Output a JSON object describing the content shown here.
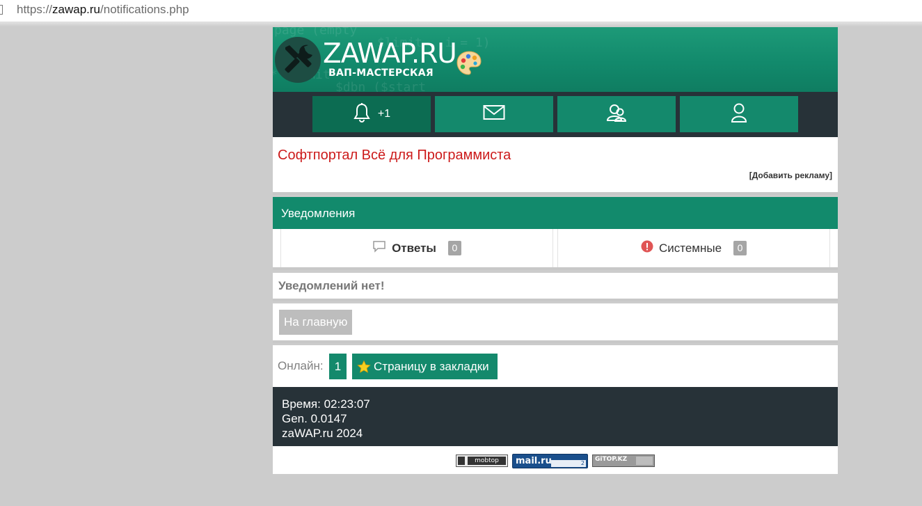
{
  "browser": {
    "url_scheme": "https://",
    "url_host": "zawap.ru",
    "url_path": "/notifications.php"
  },
  "header": {
    "logo_title": "ZAWAP.RU",
    "logo_subtitle": "ВАП-МАСТЕРСКАЯ",
    "background_code": [
      "page  (empty",
      "$limit , i = 1)",
      "$dbn  ($start",
      "* $limit"
    ]
  },
  "nav": {
    "notifications_count": "+1",
    "icons": [
      "bell-icon",
      "mail-icon",
      "users-icon",
      "user-icon"
    ]
  },
  "ad": {
    "link_text": "Софтпортал Всё для Программиста",
    "add_ad": "[Добавить рекламу]"
  },
  "notifications": {
    "title": "Уведомления",
    "tabs": [
      {
        "label": "Ответы",
        "count": "0",
        "icon": "comment-icon"
      },
      {
        "label": "Системные",
        "count": "0",
        "icon": "alert-icon"
      }
    ],
    "empty_text": "Уведомлений нет!"
  },
  "home_button": "На главную",
  "online": {
    "label": "Онлайн:",
    "count": "1",
    "bookmark": "Страницу в закладки"
  },
  "footer": {
    "time": "Время: 02:23:07",
    "gen": "Gen. 0.0147",
    "copyright": "zaWAP.ru 2024"
  },
  "counters": {
    "mobtop": "mobtop",
    "mailru": "mail.ru",
    "mailru_count": "2",
    "gitop": "GiTOP.KZ"
  },
  "colors": {
    "brand_green": "#128a6c",
    "dark": "#273238",
    "ad_red": "#cc1a1a"
  }
}
